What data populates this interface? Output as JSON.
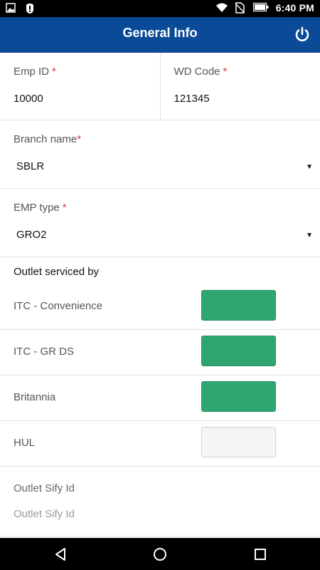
{
  "status_bar": {
    "time": "6:40 PM",
    "icons": [
      "image-icon",
      "notification-icon",
      "wifi-icon",
      "no-sim-icon",
      "battery-icon"
    ]
  },
  "app_bar": {
    "title": "General Info",
    "action_icon": "power-icon"
  },
  "form": {
    "emp_id": {
      "label": "Emp ID",
      "required_mark": "*",
      "value": "10000"
    },
    "wd_code": {
      "label": "WD Code",
      "required_mark": "*",
      "value": "121345"
    },
    "branch_name": {
      "label": "Branch name",
      "required_mark": "*",
      "value": "SBLR"
    },
    "emp_type": {
      "label": "EMP type",
      "required_mark": "*",
      "value": "GRO2"
    },
    "outlet_section_title": "Outlet serviced by",
    "outlets": [
      {
        "label": "ITC - Convenience",
        "selected": true
      },
      {
        "label": "ITC - GR DS",
        "selected": true
      },
      {
        "label": "Britannia",
        "selected": true
      },
      {
        "label": "HUL",
        "selected": false
      }
    ],
    "outlet_sify_id": {
      "label": "Outlet Sify Id",
      "placeholder": "Outlet Sify Id",
      "value": ""
    }
  },
  "colors": {
    "app_bar": "#0b4a96",
    "toggle_on": "#2fa56f",
    "required": "#e53935"
  },
  "nav_bar": {
    "icons": [
      "back-icon",
      "home-icon",
      "recents-icon"
    ]
  }
}
